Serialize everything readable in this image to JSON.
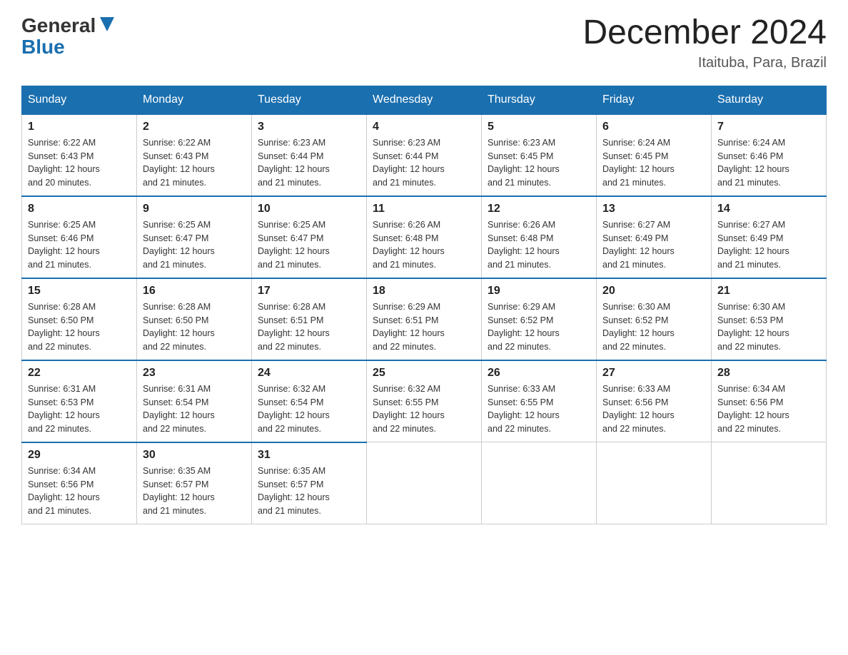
{
  "header": {
    "logo_general": "General",
    "logo_blue": "Blue",
    "month_title": "December 2024",
    "location": "Itaituba, Para, Brazil"
  },
  "days_of_week": [
    "Sunday",
    "Monday",
    "Tuesday",
    "Wednesday",
    "Thursday",
    "Friday",
    "Saturday"
  ],
  "weeks": [
    [
      {
        "day": "1",
        "sunrise": "6:22 AM",
        "sunset": "6:43 PM",
        "daylight": "12 hours and 20 minutes."
      },
      {
        "day": "2",
        "sunrise": "6:22 AM",
        "sunset": "6:43 PM",
        "daylight": "12 hours and 21 minutes."
      },
      {
        "day": "3",
        "sunrise": "6:23 AM",
        "sunset": "6:44 PM",
        "daylight": "12 hours and 21 minutes."
      },
      {
        "day": "4",
        "sunrise": "6:23 AM",
        "sunset": "6:44 PM",
        "daylight": "12 hours and 21 minutes."
      },
      {
        "day": "5",
        "sunrise": "6:23 AM",
        "sunset": "6:45 PM",
        "daylight": "12 hours and 21 minutes."
      },
      {
        "day": "6",
        "sunrise": "6:24 AM",
        "sunset": "6:45 PM",
        "daylight": "12 hours and 21 minutes."
      },
      {
        "day": "7",
        "sunrise": "6:24 AM",
        "sunset": "6:46 PM",
        "daylight": "12 hours and 21 minutes."
      }
    ],
    [
      {
        "day": "8",
        "sunrise": "6:25 AM",
        "sunset": "6:46 PM",
        "daylight": "12 hours and 21 minutes."
      },
      {
        "day": "9",
        "sunrise": "6:25 AM",
        "sunset": "6:47 PM",
        "daylight": "12 hours and 21 minutes."
      },
      {
        "day": "10",
        "sunrise": "6:25 AM",
        "sunset": "6:47 PM",
        "daylight": "12 hours and 21 minutes."
      },
      {
        "day": "11",
        "sunrise": "6:26 AM",
        "sunset": "6:48 PM",
        "daylight": "12 hours and 21 minutes."
      },
      {
        "day": "12",
        "sunrise": "6:26 AM",
        "sunset": "6:48 PM",
        "daylight": "12 hours and 21 minutes."
      },
      {
        "day": "13",
        "sunrise": "6:27 AM",
        "sunset": "6:49 PM",
        "daylight": "12 hours and 21 minutes."
      },
      {
        "day": "14",
        "sunrise": "6:27 AM",
        "sunset": "6:49 PM",
        "daylight": "12 hours and 21 minutes."
      }
    ],
    [
      {
        "day": "15",
        "sunrise": "6:28 AM",
        "sunset": "6:50 PM",
        "daylight": "12 hours and 22 minutes."
      },
      {
        "day": "16",
        "sunrise": "6:28 AM",
        "sunset": "6:50 PM",
        "daylight": "12 hours and 22 minutes."
      },
      {
        "day": "17",
        "sunrise": "6:28 AM",
        "sunset": "6:51 PM",
        "daylight": "12 hours and 22 minutes."
      },
      {
        "day": "18",
        "sunrise": "6:29 AM",
        "sunset": "6:51 PM",
        "daylight": "12 hours and 22 minutes."
      },
      {
        "day": "19",
        "sunrise": "6:29 AM",
        "sunset": "6:52 PM",
        "daylight": "12 hours and 22 minutes."
      },
      {
        "day": "20",
        "sunrise": "6:30 AM",
        "sunset": "6:52 PM",
        "daylight": "12 hours and 22 minutes."
      },
      {
        "day": "21",
        "sunrise": "6:30 AM",
        "sunset": "6:53 PM",
        "daylight": "12 hours and 22 minutes."
      }
    ],
    [
      {
        "day": "22",
        "sunrise": "6:31 AM",
        "sunset": "6:53 PM",
        "daylight": "12 hours and 22 minutes."
      },
      {
        "day": "23",
        "sunrise": "6:31 AM",
        "sunset": "6:54 PM",
        "daylight": "12 hours and 22 minutes."
      },
      {
        "day": "24",
        "sunrise": "6:32 AM",
        "sunset": "6:54 PM",
        "daylight": "12 hours and 22 minutes."
      },
      {
        "day": "25",
        "sunrise": "6:32 AM",
        "sunset": "6:55 PM",
        "daylight": "12 hours and 22 minutes."
      },
      {
        "day": "26",
        "sunrise": "6:33 AM",
        "sunset": "6:55 PM",
        "daylight": "12 hours and 22 minutes."
      },
      {
        "day": "27",
        "sunrise": "6:33 AM",
        "sunset": "6:56 PM",
        "daylight": "12 hours and 22 minutes."
      },
      {
        "day": "28",
        "sunrise": "6:34 AM",
        "sunset": "6:56 PM",
        "daylight": "12 hours and 22 minutes."
      }
    ],
    [
      {
        "day": "29",
        "sunrise": "6:34 AM",
        "sunset": "6:56 PM",
        "daylight": "12 hours and 21 minutes."
      },
      {
        "day": "30",
        "sunrise": "6:35 AM",
        "sunset": "6:57 PM",
        "daylight": "12 hours and 21 minutes."
      },
      {
        "day": "31",
        "sunrise": "6:35 AM",
        "sunset": "6:57 PM",
        "daylight": "12 hours and 21 minutes."
      },
      null,
      null,
      null,
      null
    ]
  ],
  "labels": {
    "sunrise": "Sunrise:",
    "sunset": "Sunset:",
    "daylight": "Daylight:"
  }
}
